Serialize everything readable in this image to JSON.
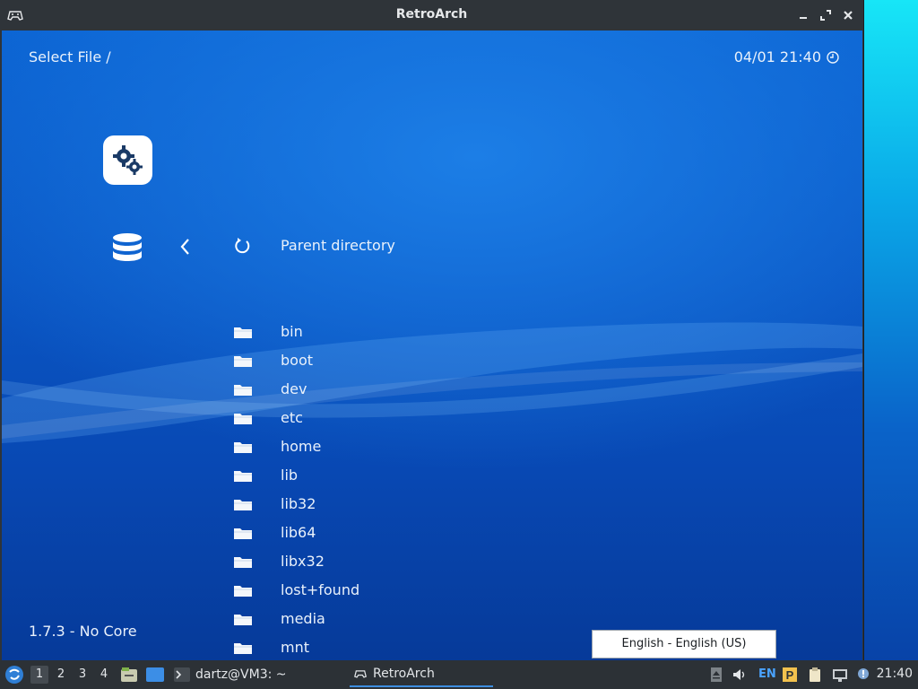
{
  "window": {
    "title": "RetroArch"
  },
  "header": {
    "left": "Select File /",
    "right": "04/01 21:40"
  },
  "sidebar": {
    "settings_icon": "gears-icon",
    "db_icon": "database-icon"
  },
  "list": {
    "parent": "Parent directory",
    "items": [
      "bin",
      "boot",
      "dev",
      "etc",
      "home",
      "lib",
      "lib32",
      "lib64",
      "libx32",
      "lost+found",
      "media",
      "mnt"
    ]
  },
  "footer": {
    "version": "1.7.3 - No Core"
  },
  "tooltip": {
    "text": "English - English (US)"
  },
  "taskbar": {
    "workspaces": [
      "1",
      "2",
      "3",
      "4"
    ],
    "terminal_task": "dartz@VM3: ~",
    "retroarch_task": "RetroArch",
    "lang": "EN",
    "clock": "21:40"
  },
  "colors": {
    "accent": "#0a56c4",
    "taskbar": "#2c3136",
    "titlebar": "#2f3439"
  }
}
